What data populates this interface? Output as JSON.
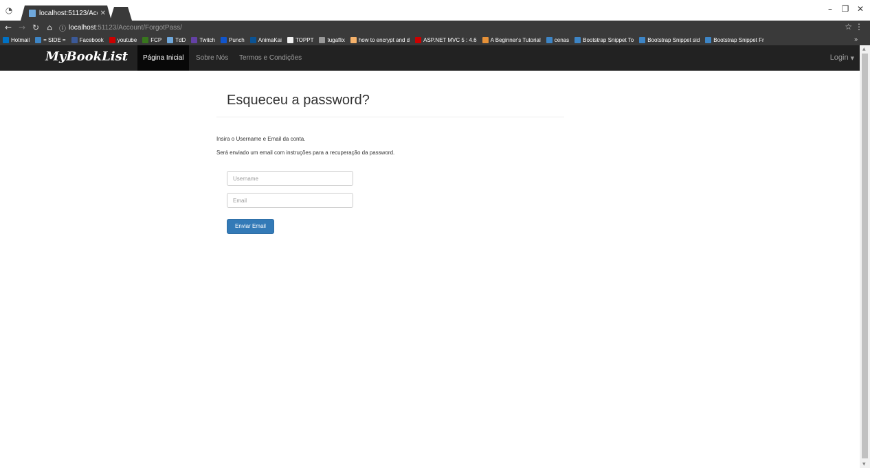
{
  "browser": {
    "tab_title": "localhost:51123/Account",
    "url_host": "localhost",
    "url_path": ":51123/Account/ForgotPass/",
    "bookmarks": [
      {
        "label": "Hotmail",
        "color": "#0072c6"
      },
      {
        "label": "= SIDE =",
        "color": "#3d85c6"
      },
      {
        "label": "Facebook",
        "color": "#3b5998"
      },
      {
        "label": "youtube",
        "color": "#cc0000"
      },
      {
        "label": "FCP",
        "color": "#38761d"
      },
      {
        "label": "TdD",
        "color": "#6fa8dc"
      },
      {
        "label": "Twitch",
        "color": "#6441a5"
      },
      {
        "label": "Punch",
        "color": "#1155cc"
      },
      {
        "label": "AnimaKai",
        "color": "#0b5394"
      },
      {
        "label": "TOPPT",
        "color": "#f1f1f1"
      },
      {
        "label": "tugaflix",
        "color": "#999999"
      },
      {
        "label": "how to encrypt and d",
        "color": "#f6b26b"
      },
      {
        "label": "ASP.NET MVC 5 : 4.6",
        "color": "#cc0000"
      },
      {
        "label": "A Beginner's Tutorial",
        "color": "#e69138"
      },
      {
        "label": "cenas",
        "color": "#3d85c6"
      },
      {
        "label": "Bootstrap Snippet To",
        "color": "#3d85c6"
      },
      {
        "label": "Bootstrap Snippet sid",
        "color": "#3d85c6"
      },
      {
        "label": "Bootstrap Snippet Fr",
        "color": "#3d85c6"
      }
    ]
  },
  "navbar": {
    "brand": "MyBookList",
    "links": [
      "Página Inicial",
      "Sobre Nós",
      "Termos e Condições"
    ],
    "login": "Login"
  },
  "page": {
    "heading": "Esqueceu a password?",
    "line1": "Insira o Username e Email da conta.",
    "line2": "Será enviado um email com instruções para a recuperação da password.",
    "username_placeholder": "Username",
    "email_placeholder": "Email",
    "submit_label": "Enviar Email"
  },
  "colors": {
    "navbar_bg": "#222222",
    "primary": "#337ab7"
  }
}
